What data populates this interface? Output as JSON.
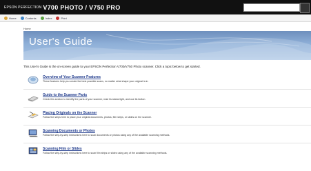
{
  "window": {
    "title_prefix": "EPSON PERFECTION",
    "title": "V700 PHOTO / V750 PRO"
  },
  "toolbar": {
    "items": [
      {
        "label": "Home",
        "icon": "home-icon",
        "color": "#d9a43a"
      },
      {
        "label": "Contents",
        "icon": "contents-icon",
        "color": "#3f86c8"
      },
      {
        "label": "Index",
        "icon": "index-icon",
        "color": "#58a13f"
      },
      {
        "label": "Print",
        "icon": "print-icon",
        "color": "#c6322e"
      }
    ]
  },
  "breadcrumb": "Home",
  "banner": {
    "title": "User's Guide"
  },
  "intro": "This User's Guide is the on-screen guide to your EPSON Perfection V700/V750 Photo scanner. Click a topic below to get started.",
  "topics": [
    {
      "title": "Overview of Your Scanner Features",
      "desc": "These features help you create the best possible scans, no matter what shape your original is in.",
      "icon": "scanner-features-icon"
    },
    {
      "title": "Guide to the Scanner Parts",
      "desc": "Check this section to identify the parts of your scanner, read its status light, and use its button.",
      "icon": "scanner-parts-icon"
    },
    {
      "title": "Placing Originals on the Scanner",
      "desc": "Follow the steps here to place your original documents, photos, film strips, or slides on the scanner.",
      "icon": "placing-originals-icon"
    },
    {
      "title": "Scanning Documents or Photos",
      "desc": "Follow the step-by-step instructions here to scan documents or photos using any of the available scanning methods.",
      "icon": "scanning-documents-icon"
    },
    {
      "title": "Scanning Film or Slides",
      "desc": "Follow the step-by-step instructions here to scan film strips or slides using any of the available scanning methods.",
      "icon": "scanning-film-icon"
    }
  ]
}
